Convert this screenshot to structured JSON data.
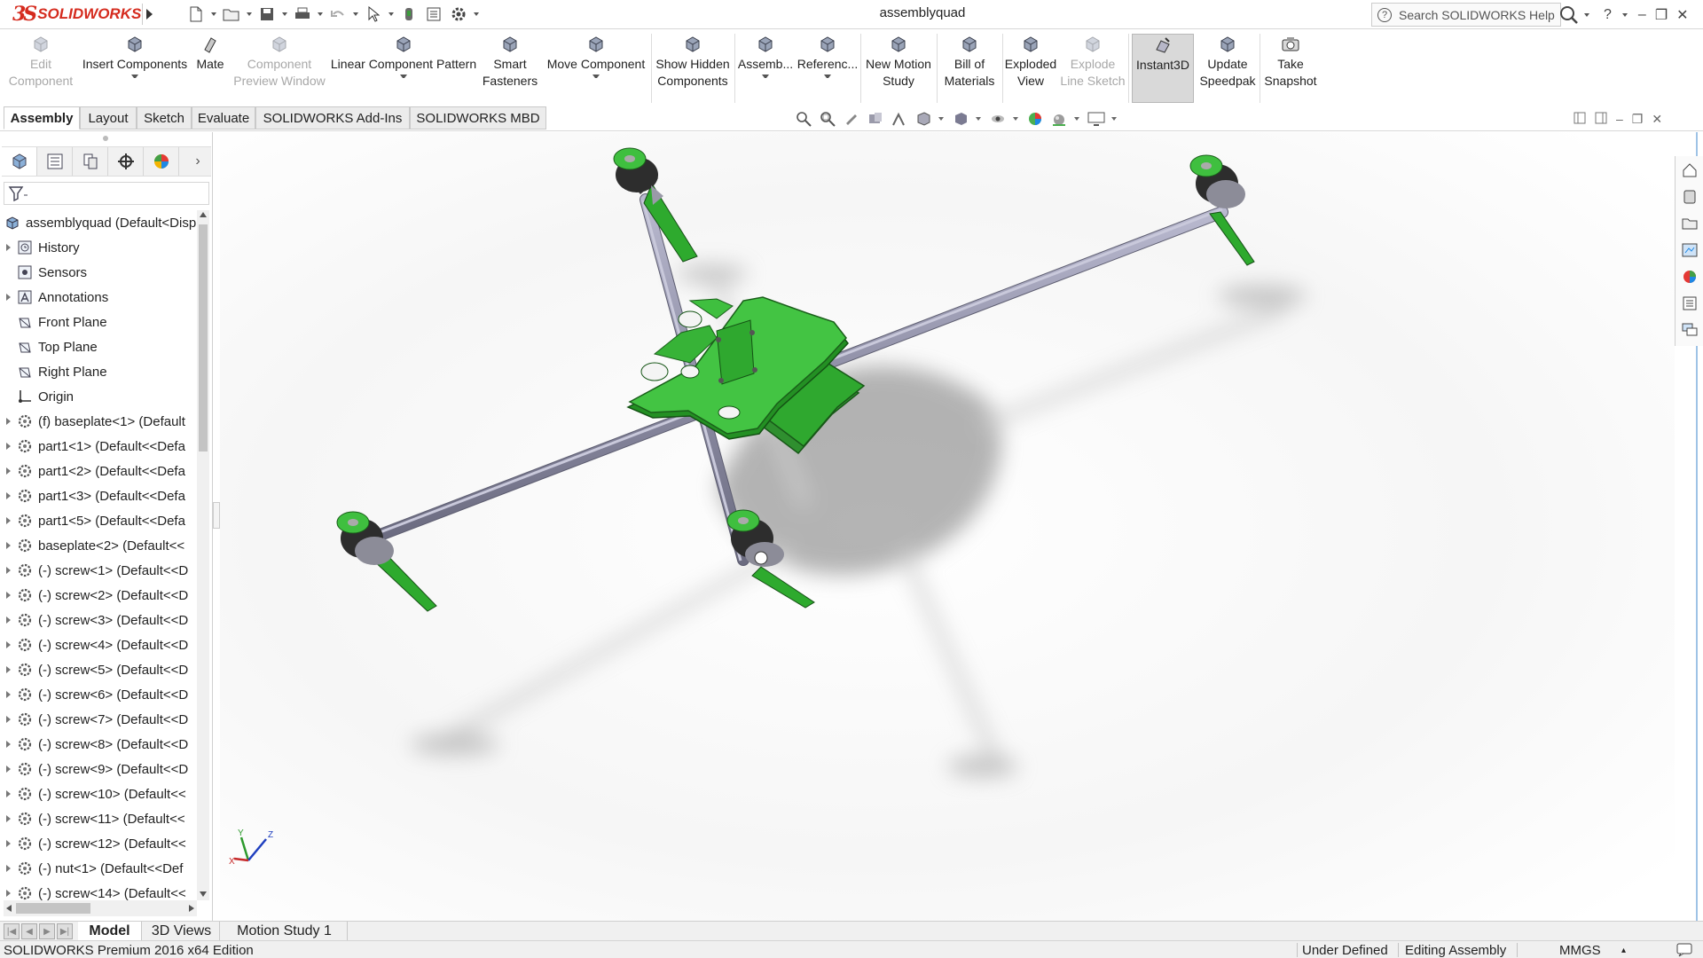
{
  "app": {
    "logo_ds": "3S",
    "logo_name": "SOLIDWORKS",
    "document_title": "assemblyquad",
    "help_search_placeholder": "Search SOLIDWORKS Help",
    "help_label": "?",
    "min_label": "–",
    "restore_label": "❐",
    "close_label": "✕"
  },
  "commands": [
    {
      "line1": "Edit",
      "line2": "Component",
      "disabled": true,
      "icon": "edit-component-icon"
    },
    {
      "line1": "Insert Components",
      "line2": "",
      "dropdown": true,
      "icon": "insert-components-icon"
    },
    {
      "line1": "Mate",
      "line2": "",
      "icon": "mate-icon"
    },
    {
      "line1": "Component",
      "line2": "Preview Window",
      "disabled": true,
      "icon": "component-preview-icon"
    },
    {
      "line1": "Linear Component Pattern",
      "line2": "",
      "dropdown": true,
      "icon": "linear-pattern-icon"
    },
    {
      "line1": "Smart",
      "line2": "Fasteners",
      "icon": "smart-fasteners-icon"
    },
    {
      "line1": "Move Component",
      "line2": "",
      "dropdown": true,
      "icon": "move-component-icon"
    },
    {
      "line1": "Show Hidden",
      "line2": "Components",
      "icon": "show-hidden-icon"
    },
    {
      "line1": "Assemb...",
      "line2": "",
      "dropdown": true,
      "icon": "assembly-features-icon"
    },
    {
      "line1": "Referenc...",
      "line2": "",
      "dropdown": true,
      "icon": "reference-geometry-icon"
    },
    {
      "line1": "New Motion",
      "line2": "Study",
      "icon": "motion-study-icon"
    },
    {
      "line1": "Bill of",
      "line2": "Materials",
      "icon": "bom-icon"
    },
    {
      "line1": "Exploded",
      "line2": "View",
      "icon": "exploded-view-icon"
    },
    {
      "line1": "Explode",
      "line2": "Line Sketch",
      "disabled": true,
      "icon": "explode-line-icon"
    },
    {
      "line1": "Instant3D",
      "line2": "",
      "active": true,
      "icon": "instant3d-icon"
    },
    {
      "line1": "Update",
      "line2": "Speedpak",
      "icon": "speedpak-icon"
    },
    {
      "line1": "Take",
      "line2": "Snapshot",
      "icon": "snapshot-icon"
    }
  ],
  "tabs": [
    "Assembly",
    "Layout",
    "Sketch",
    "Evaluate",
    "SOLIDWORKS Add-Ins",
    "SOLIDWORKS MBD"
  ],
  "active_tab": "Assembly",
  "tree": {
    "root": "assemblyquad  (Default<Disp",
    "items": [
      {
        "label": "History",
        "expand": true,
        "icon": "history-icon"
      },
      {
        "label": "Sensors",
        "expand": false,
        "icon": "sensors-icon"
      },
      {
        "label": "Annotations",
        "expand": true,
        "icon": "annotations-icon"
      },
      {
        "label": "Front Plane",
        "expand": false,
        "icon": "plane-icon"
      },
      {
        "label": "Top Plane",
        "expand": false,
        "icon": "plane-icon"
      },
      {
        "label": "Right Plane",
        "expand": false,
        "icon": "plane-icon"
      },
      {
        "label": "Origin",
        "expand": false,
        "icon": "origin-icon"
      },
      {
        "label": "(f) baseplate<1> (Default",
        "expand": true,
        "icon": "part-icon"
      },
      {
        "label": "part1<1> (Default<<Defa",
        "expand": true,
        "icon": "part-icon"
      },
      {
        "label": "part1<2> (Default<<Defa",
        "expand": true,
        "icon": "part-icon"
      },
      {
        "label": "part1<3> (Default<<Defa",
        "expand": true,
        "icon": "part-icon"
      },
      {
        "label": "part1<5> (Default<<Defa",
        "expand": true,
        "icon": "part-icon"
      },
      {
        "label": "baseplate<2> (Default<<",
        "expand": true,
        "icon": "part-icon"
      },
      {
        "label": "(-) screw<1> (Default<<D",
        "expand": true,
        "icon": "part-icon"
      },
      {
        "label": "(-) screw<2> (Default<<D",
        "expand": true,
        "icon": "part-icon"
      },
      {
        "label": "(-) screw<3> (Default<<D",
        "expand": true,
        "icon": "part-icon"
      },
      {
        "label": "(-) screw<4> (Default<<D",
        "expand": true,
        "icon": "part-icon"
      },
      {
        "label": "(-) screw<5> (Default<<D",
        "expand": true,
        "icon": "part-icon"
      },
      {
        "label": "(-) screw<6> (Default<<D",
        "expand": true,
        "icon": "part-icon"
      },
      {
        "label": "(-) screw<7> (Default<<D",
        "expand": true,
        "icon": "part-icon"
      },
      {
        "label": "(-) screw<8> (Default<<D",
        "expand": true,
        "icon": "part-icon"
      },
      {
        "label": "(-) screw<9> (Default<<D",
        "expand": true,
        "icon": "part-icon"
      },
      {
        "label": "(-) screw<10> (Default<<",
        "expand": true,
        "icon": "part-icon"
      },
      {
        "label": "(-) screw<11> (Default<<",
        "expand": true,
        "icon": "part-icon"
      },
      {
        "label": "(-) screw<12> (Default<<",
        "expand": true,
        "icon": "part-icon"
      },
      {
        "label": "(-) nut<1> (Default<<Def",
        "expand": true,
        "icon": "part-icon"
      },
      {
        "label": "(-) screw<14> (Default<<",
        "expand": true,
        "icon": "part-icon"
      }
    ]
  },
  "triad": {
    "y": "Y",
    "z": "Z",
    "x": "X"
  },
  "bottom_tabs": [
    "Model",
    "3D Views",
    "Motion Study 1"
  ],
  "active_bottom_tab": "Model",
  "status": {
    "edition": "SOLIDWORKS Premium 2016 x64 Edition",
    "state": "Under Defined",
    "mode": "Editing Assembly",
    "units": "MMGS",
    "units_caret": "▴"
  },
  "colors": {
    "brand_red": "#d52b1e",
    "part_green": "#3fbf3f",
    "arm_gray": "#8f8fa6",
    "selection_blue": "#9ec3e6"
  }
}
